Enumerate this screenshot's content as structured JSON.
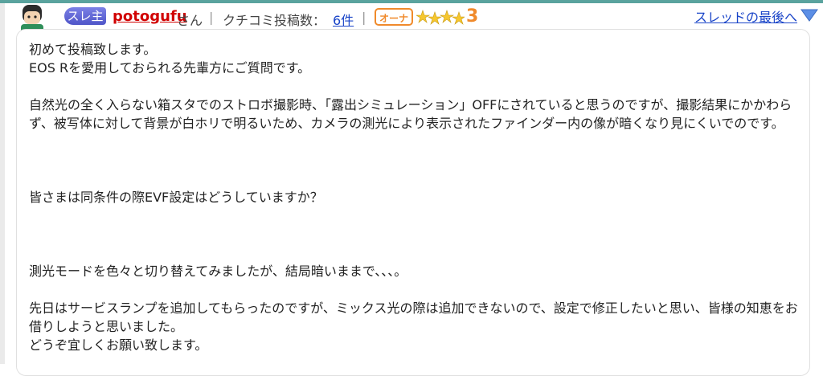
{
  "header": {
    "badge_thread_owner": "スレ主",
    "username": "potogufu",
    "honorific": "さん",
    "separator": "|",
    "review_label": "クチコミ投稿数：",
    "review_count": "6件",
    "owner_badge": "オーナー",
    "rank_number": "3",
    "last_link": "スレッドの最後へ"
  },
  "icons": {
    "avatar": "avatar-icon",
    "stars": "star-rank-icon",
    "down_arrow": "down-arrow-icon"
  },
  "colors": {
    "accent_top": "#5aa39e",
    "username": "#d10000",
    "link": "#1a45c8",
    "orange": "#f08a2b",
    "badge_purple": "#5b62d6"
  },
  "post": {
    "p1": "初めて投稿致します。\nEOS Rを愛用しておられる先輩方にご質問です。",
    "p2": "自然光の全く入らない箱スタでのストロボ撮影時、「露出シミュレーション」OFFにされていると思うのですが、撮影結果にかかわらず、被写体に対して背景が白ホリで明るいため、カメラの測光により表示されたファインダー内の像が暗くなり見にくいでのです。",
    "p3": "皆さまは同条件の際EVF設定はどうしていますか？",
    "p4": "測光モードを色々と切り替えてみましたが、結局暗いままで、、、。",
    "p5": "先日はサービスランプを追加してもらったのですが、ミックス光の際は追加できないので、設定で修正したいと思い、皆様の知恵をお借りしようと思いました。\nどうぞ宜しくお願い致します。"
  }
}
